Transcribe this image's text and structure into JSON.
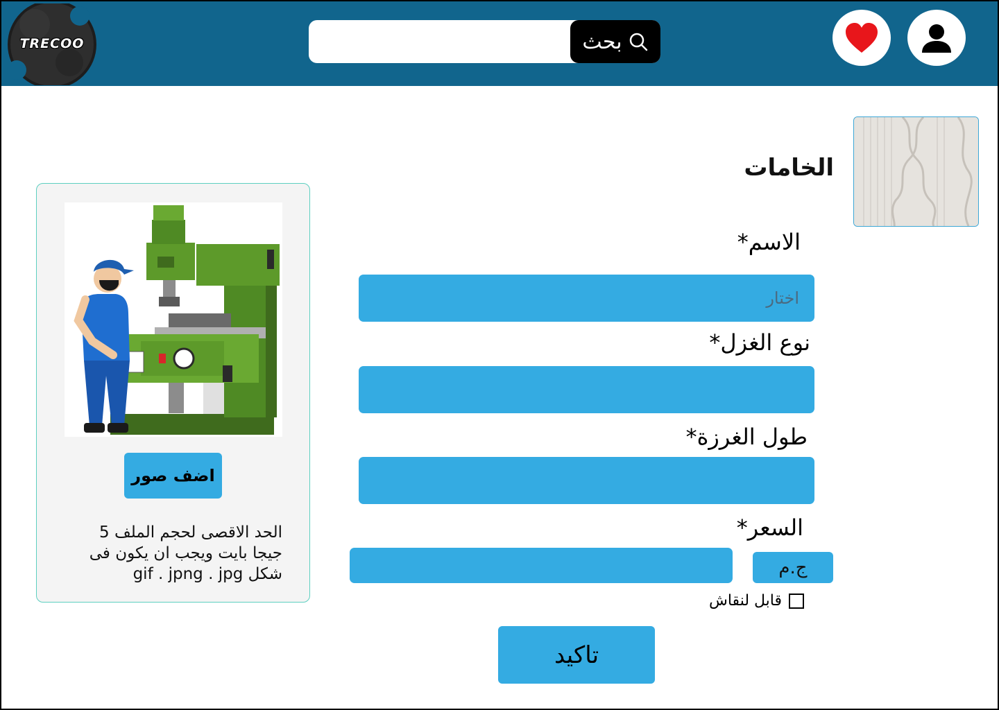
{
  "header": {
    "logo_text": "TRECOO",
    "search": {
      "placeholder": "",
      "button_label": "بحث"
    }
  },
  "category": {
    "title": "الخامات"
  },
  "form": {
    "name_label": "الاسم*",
    "name_placeholder": "اختار",
    "yarn_type_label": "نوع الغزل*",
    "stitch_length_label": "طول الغرزة*",
    "price_label": "السعر*",
    "currency": "ج.م",
    "negotiable_label": "قابل لنقاش",
    "negotiable_checked": false,
    "confirm_label": "تاكيد"
  },
  "upload": {
    "button_label": "اضف صور",
    "note": "الحد الاقصى لحجم الملف 5 جيجا بايت ويجب ان يكون فى شكل gif . jpng . jpg"
  },
  "colors": {
    "header_bg": "#11658d",
    "accent": "#34abe2",
    "heart": "#e8161b"
  }
}
